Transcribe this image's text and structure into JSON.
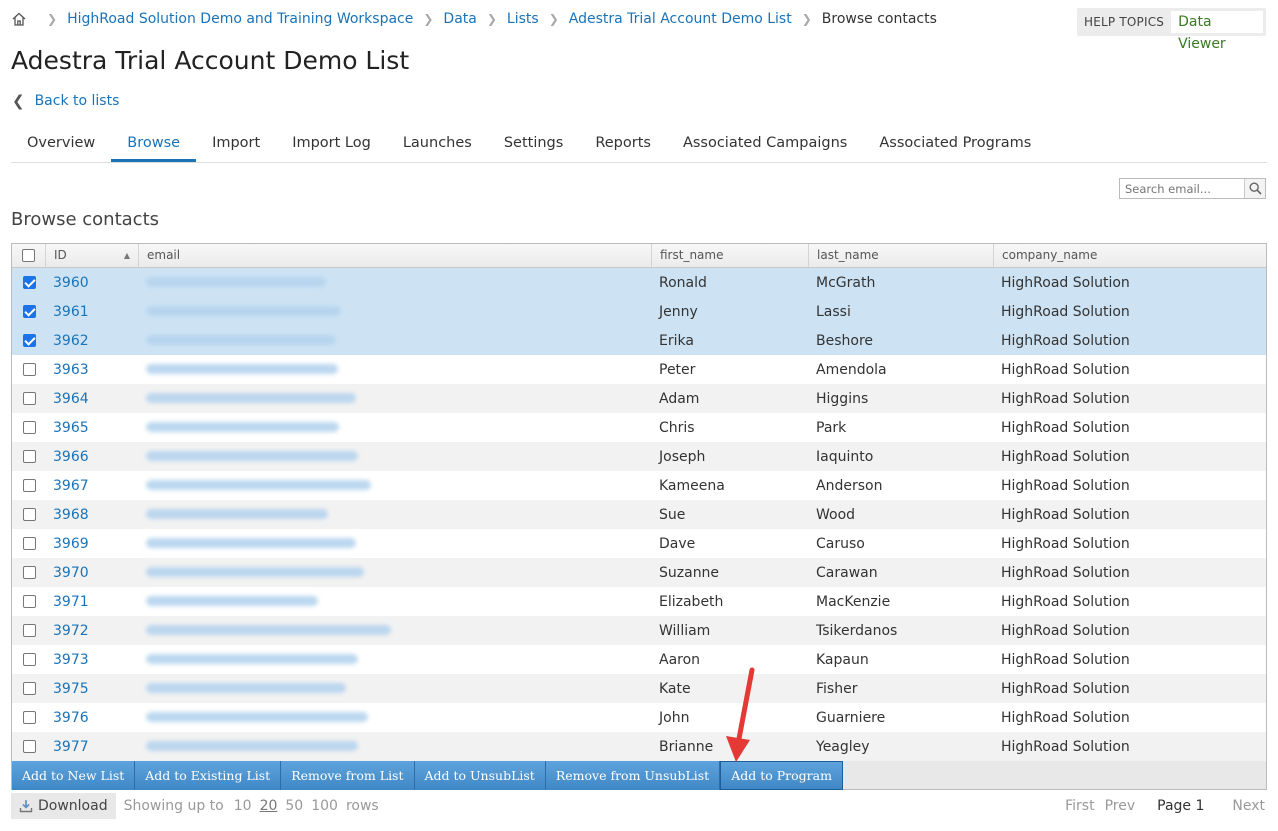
{
  "breadcrumb": {
    "items": [
      "HighRoad Solution Demo and Training Workspace",
      "Data",
      "Lists",
      "Adestra Trial Account Demo List"
    ],
    "current": "Browse contacts"
  },
  "help": {
    "topics": "HELP TOPICS",
    "viewer": "Data Viewer"
  },
  "page_title": "Adestra Trial Account Demo List",
  "back_link": "Back to lists",
  "tabs": [
    "Overview",
    "Browse",
    "Import",
    "Import Log",
    "Launches",
    "Settings",
    "Reports",
    "Associated Campaigns",
    "Associated Programs"
  ],
  "active_tab": "Browse",
  "search": {
    "placeholder": "Search email..."
  },
  "section_title": "Browse contacts",
  "grid": {
    "headers": {
      "id": "ID",
      "email": "email",
      "first": "first_name",
      "last": "last_name",
      "company": "company_name"
    },
    "rows": [
      {
        "id": "3960",
        "first": "Ronald",
        "last": "McGrath",
        "company": "HighRoad Solution",
        "checked": true
      },
      {
        "id": "3961",
        "first": "Jenny",
        "last": "Lassi",
        "company": "HighRoad Solution",
        "checked": true
      },
      {
        "id": "3962",
        "first": "Erika",
        "last": "Beshore",
        "company": "HighRoad Solution",
        "checked": true
      },
      {
        "id": "3963",
        "first": "Peter",
        "last": "Amendola",
        "company": "HighRoad Solution",
        "checked": false
      },
      {
        "id": "3964",
        "first": "Adam",
        "last": "Higgins",
        "company": "HighRoad Solution",
        "checked": false
      },
      {
        "id": "3965",
        "first": "Chris",
        "last": "Park",
        "company": "HighRoad Solution",
        "checked": false
      },
      {
        "id": "3966",
        "first": "Joseph",
        "last": "Iaquinto",
        "company": "HighRoad Solution",
        "checked": false
      },
      {
        "id": "3967",
        "first": "Kameena",
        "last": "Anderson",
        "company": "HighRoad Solution",
        "checked": false
      },
      {
        "id": "3968",
        "first": "Sue",
        "last": "Wood",
        "company": "HighRoad Solution",
        "checked": false
      },
      {
        "id": "3969",
        "first": "Dave",
        "last": "Caruso",
        "company": "HighRoad Solution",
        "checked": false
      },
      {
        "id": "3970",
        "first": "Suzanne",
        "last": "Carawan",
        "company": "HighRoad Solution",
        "checked": false
      },
      {
        "id": "3971",
        "first": "Elizabeth",
        "last": "MacKenzie",
        "company": "HighRoad Solution",
        "checked": false
      },
      {
        "id": "3972",
        "first": "William",
        "last": "Tsikerdanos",
        "company": "HighRoad Solution",
        "checked": false
      },
      {
        "id": "3973",
        "first": "Aaron",
        "last": "Kapaun",
        "company": "HighRoad Solution",
        "checked": false
      },
      {
        "id": "3975",
        "first": "Kate",
        "last": "Fisher",
        "company": "HighRoad Solution",
        "checked": false
      },
      {
        "id": "3976",
        "first": "John",
        "last": "Guarniere",
        "company": "HighRoad Solution",
        "checked": false
      },
      {
        "id": "3977",
        "first": "Brianne",
        "last": "Yeagley",
        "company": "HighRoad Solution",
        "checked": false
      }
    ]
  },
  "actions": [
    "Add to New List",
    "Add to Existing List",
    "Remove from List",
    "Add to UnsubList",
    "Remove from UnsubList",
    "Add to Program"
  ],
  "footer": {
    "download": "Download",
    "showing": "Showing up to",
    "limits": [
      "10",
      "20",
      "50",
      "100"
    ],
    "current_limit": "20",
    "rows_label": "rows",
    "first": "First",
    "prev": "Prev",
    "page": "Page 1",
    "next": "Next"
  },
  "colors": {
    "accent": "#1a73b8",
    "selected_row": "#cde3f4",
    "annotation_arrow": "#e53935"
  }
}
